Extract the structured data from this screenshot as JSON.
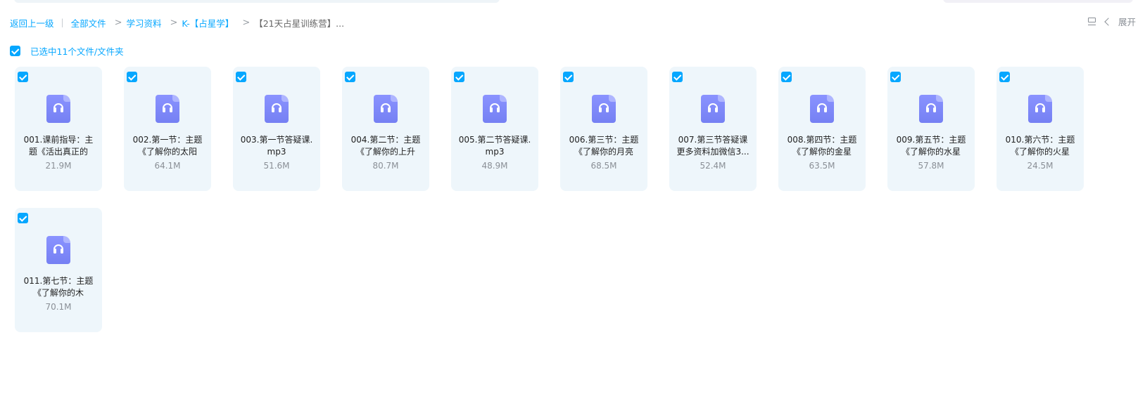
{
  "breadcrumb": {
    "back": "返回上一级",
    "items": [
      "全部文件",
      "学习资料",
      "K-【占星学】",
      "【21天占星训练营】..."
    ]
  },
  "toolbar": {
    "expand_label": "展开"
  },
  "selection": {
    "label": "已选中11个文件/文件夹"
  },
  "files": [
    {
      "name": "001.课前指导：主题《活出真正的",
      "size": "21.9M"
    },
    {
      "name": "002.第一节：主题《了解你的太阳",
      "size": "64.1M"
    },
    {
      "name": "003.第一节答疑课.mp3",
      "size": "51.6M"
    },
    {
      "name": "004.第二节：主题《了解你的上升",
      "size": "80.7M"
    },
    {
      "name": "005.第二节答疑课.mp3",
      "size": "48.9M"
    },
    {
      "name": "006.第三节：主题《了解你的月亮",
      "size": "68.5M"
    },
    {
      "name": "007.第三节答疑课更多资料加微信3...",
      "size": "52.4M"
    },
    {
      "name": "008.第四节：主题《了解你的金星",
      "size": "63.5M"
    },
    {
      "name": "009.第五节：主题《了解你的水星",
      "size": "57.8M"
    },
    {
      "name": "010.第六节：主题《了解你的火星",
      "size": "24.5M"
    },
    {
      "name": "011.第七节：主题《了解你的木",
      "size": "70.1M"
    }
  ],
  "icons": {
    "file_icon": "audio-file-icon",
    "accent": "#06a7ff",
    "file_icon_color": "#7b85f7"
  }
}
